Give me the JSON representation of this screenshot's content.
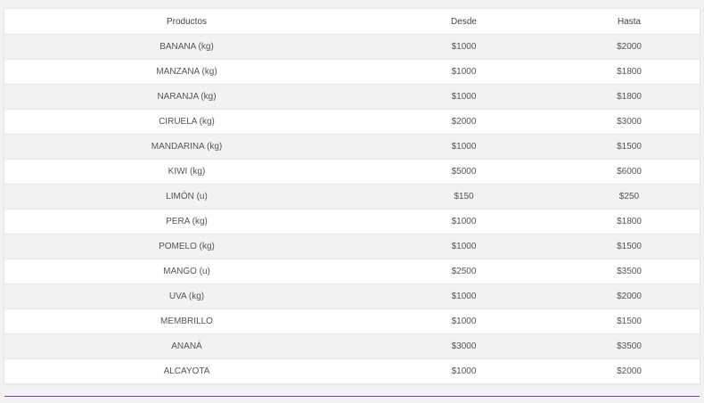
{
  "table": {
    "headers": {
      "product": "Productos",
      "from": "Desde",
      "to": "Hasta"
    },
    "rows": [
      {
        "product": "BANANA (kg)",
        "from": "$1000",
        "to": "$2000"
      },
      {
        "product": "MANZANA (kg)",
        "from": "$1000",
        "to": "$1800"
      },
      {
        "product": "NARANJA (kg)",
        "from": "$1000",
        "to": "$1800"
      },
      {
        "product": "CIRUELA (kg)",
        "from": "$2000",
        "to": "$3000"
      },
      {
        "product": "MANDARINA (kg)",
        "from": "$1000",
        "to": "$1500"
      },
      {
        "product": "KIWI (kg)",
        "from": "$5000",
        "to": "$6000"
      },
      {
        "product": "LIMÓN (u)",
        "from": "$150",
        "to": "$250"
      },
      {
        "product": "PERA (kg)",
        "from": "$1000",
        "to": "$1800"
      },
      {
        "product": "POMELO (kg)",
        "from": "$1000",
        "to": "$1500"
      },
      {
        "product": "MANGO (u)",
        "from": "$2500",
        "to": "$3500"
      },
      {
        "product": "UVA (kg)",
        "from": "$1000",
        "to": "$2000"
      },
      {
        "product": "MEMBRILLO",
        "from": "$1000",
        "to": "$1500"
      },
      {
        "product": "ANANÁ",
        "from": "$3000",
        "to": "$3500"
      },
      {
        "product": "ALCAYOTA",
        "from": "$1000",
        "to": "$2000"
      }
    ]
  },
  "colors": {
    "accent_line": "#7a3f8f",
    "row_stripe": "#f2f2f2"
  }
}
